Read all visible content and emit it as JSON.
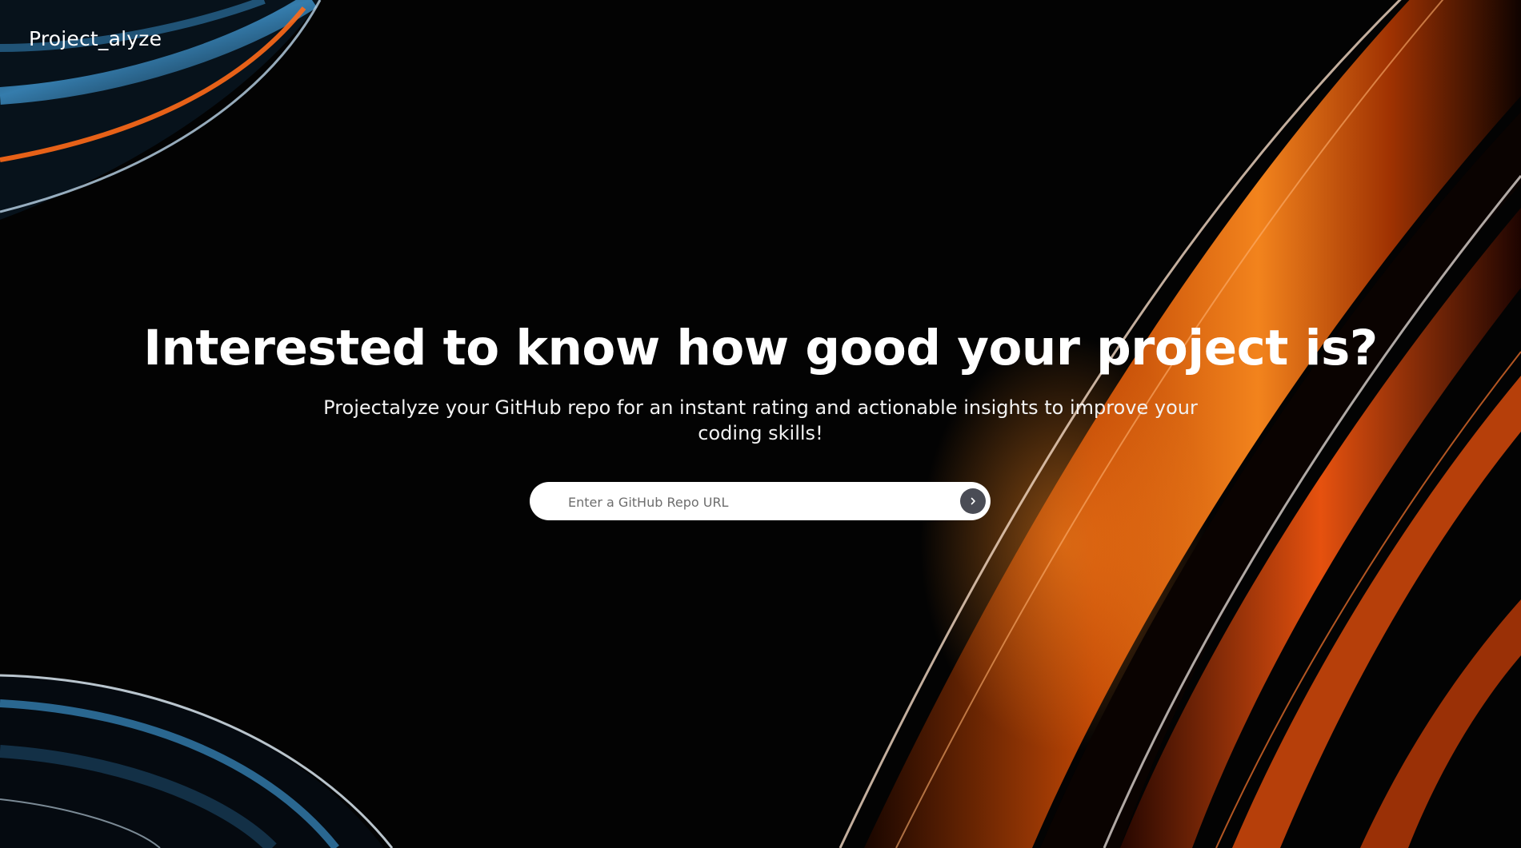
{
  "brand": {
    "logo_text": "Project_alyze"
  },
  "hero": {
    "title": "Interested to know how good your project is?",
    "subtitle": "Projectalyze your GitHub repo for an instant rating and actionable insights to improve your coding skills!"
  },
  "search": {
    "placeholder": "Enter a GitHub Repo URL",
    "value": "",
    "submit_icon": "chevron-right-icon"
  },
  "colors": {
    "background": "#030303",
    "accent_orange": "#ff6a10",
    "accent_blue": "#3a8fc8",
    "button_bg": "#4a4c55"
  }
}
